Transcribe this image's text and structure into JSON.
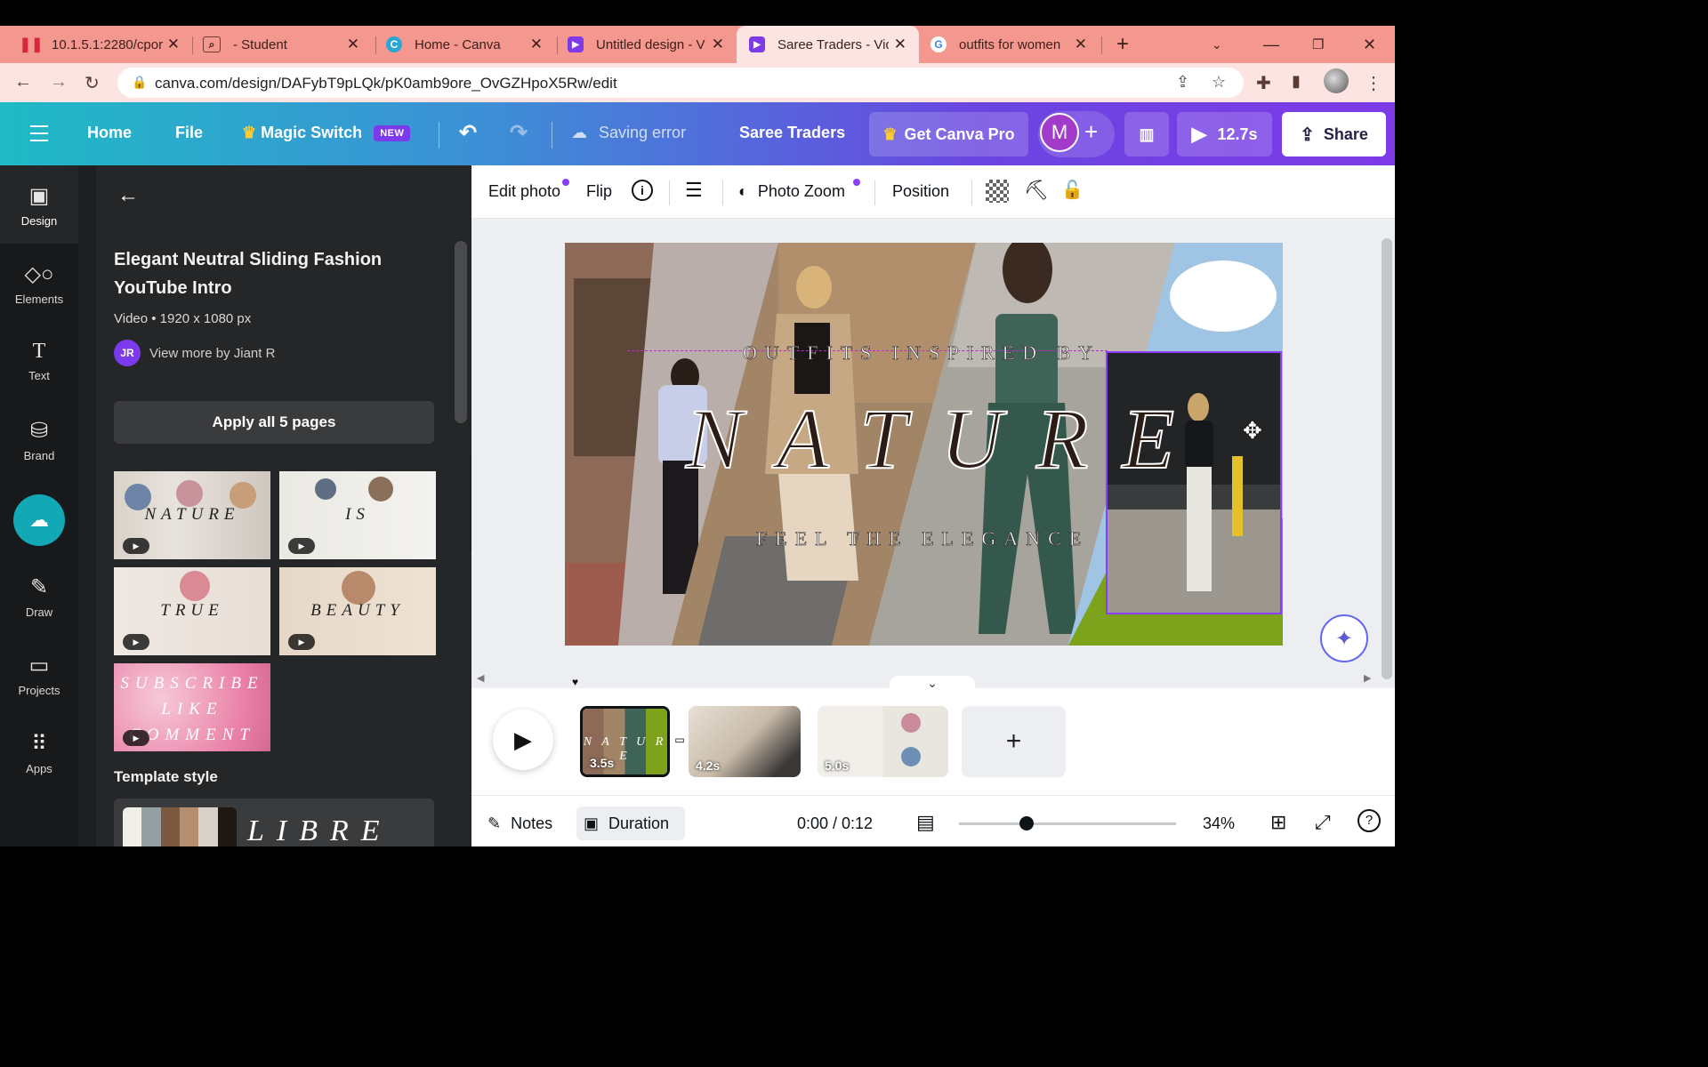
{
  "browser": {
    "tabs": [
      {
        "title": "10.1.5.1:2280/cpor",
        "icon": "pause-icon"
      },
      {
        "title": "- Student",
        "icon": "app-icon"
      },
      {
        "title": "Home - Canva",
        "icon": "canva-icon"
      },
      {
        "title": "Untitled design - V",
        "icon": "canva-video-icon"
      },
      {
        "title": "Saree Traders - Vid",
        "icon": "canva-video-icon"
      },
      {
        "title": "outfits for women",
        "icon": "google-icon"
      }
    ],
    "new_tab": "+",
    "url": "canva.com/design/DAFybT9pLQk/pK0amb9ore_OvGZHpoX5Rw/edit"
  },
  "header": {
    "home": "Home",
    "file": "File",
    "magic_switch": "Magic Switch",
    "new_badge": "NEW",
    "saving_status": "Saving error",
    "design_name": "Saree Traders",
    "get_pro": "Get Canva Pro",
    "avatar_letter": "M",
    "duration": "12.7s",
    "share": "Share"
  },
  "rail": {
    "items": [
      {
        "label": "Design",
        "icon": "design-icon"
      },
      {
        "label": "Elements",
        "icon": "elements-icon"
      },
      {
        "label": "Text",
        "icon": "text-icon"
      },
      {
        "label": "Brand",
        "icon": "brand-icon"
      },
      {
        "label": "Draw",
        "icon": "draw-icon"
      },
      {
        "label": "Projects",
        "icon": "projects-icon"
      },
      {
        "label": "Apps",
        "icon": "apps-icon"
      }
    ]
  },
  "panel": {
    "title": "Elegant Neutral Sliding Fashion YouTube Intro",
    "meta": "Video • 1920 x 1080 px",
    "author_initials": "JR",
    "author_link": "View more by Jiant R",
    "apply_button": "Apply all 5 pages",
    "thumbnails": [
      {
        "word": "NATURE"
      },
      {
        "word": "IS"
      },
      {
        "word": "TRUE"
      },
      {
        "word": "BEAUTY"
      },
      {
        "word": "SUBSCRIBE LIKE COMMENT"
      }
    ],
    "template_style_label": "Template style",
    "template_style_font": "LIBRE"
  },
  "toolbar": {
    "edit_photo": "Edit photo",
    "flip": "Flip",
    "photo_zoom": "Photo Zoom",
    "position": "Position"
  },
  "canvas": {
    "top_text": "OUTFITS INSPIRED BY",
    "main_text": "NATURE",
    "bottom_text": "FEEL THE ELEGANCE"
  },
  "timeline": {
    "pages": [
      {
        "duration": "3.5s"
      },
      {
        "duration": "4.2s"
      },
      {
        "duration": "5.0s"
      }
    ],
    "add_page": "+"
  },
  "footer": {
    "notes": "Notes",
    "duration": "Duration",
    "time": "0:00 / 0:12",
    "zoom_percent": "34%",
    "zoom_level": 0.34
  },
  "colors": {
    "browser_tabbar": "#f4978e",
    "canva_gradient_start": "#1fbac6",
    "canva_gradient_end": "#7d3ae6",
    "accent_purple": "#8b3dff",
    "sidebar_dark": "#18191b",
    "panel_dark": "#252627"
  }
}
